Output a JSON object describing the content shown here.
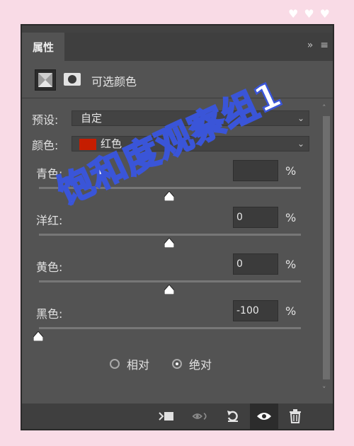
{
  "panel": {
    "tab_title": "属性",
    "tab_menu_icon": "double-chevron-right-icon",
    "adjustment_title": "可选颜色"
  },
  "preset": {
    "label": "预设:",
    "value": "自定"
  },
  "color": {
    "label": "颜色:",
    "value": "红色",
    "swatch_color": "#c51d00"
  },
  "sliders": [
    {
      "label": "青色:",
      "value": "",
      "unit": "%"
    },
    {
      "label": "洋红:",
      "value": "0",
      "unit": "%"
    },
    {
      "label": "黄色:",
      "value": "0",
      "unit": "%"
    },
    {
      "label": "黑色:",
      "value": "-100",
      "unit": "%"
    }
  ],
  "method": {
    "relative_label": "相对",
    "absolute_label": "绝对",
    "selected": "绝对"
  },
  "watermark_text": "饱和度观察组1",
  "colors": {
    "panel_bg": "#535353",
    "background": "#f9dbe6",
    "watermark_stroke": "#3a55d8"
  }
}
